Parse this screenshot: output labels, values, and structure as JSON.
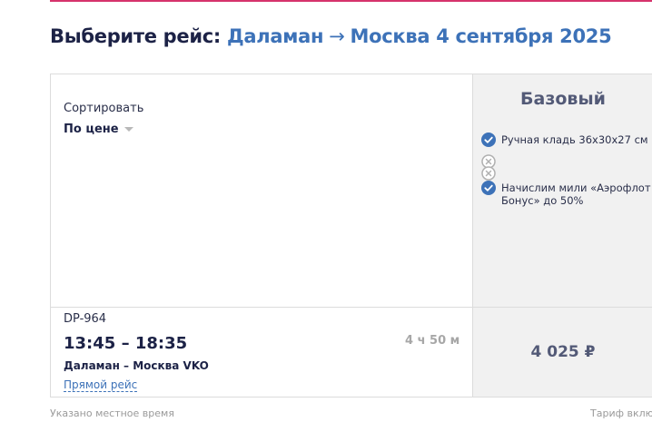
{
  "header": {
    "label": "Выберите рейс:",
    "origin": "Даламан",
    "arrow": "→",
    "destination_date": "Москва 4 сентября 2025"
  },
  "sort": {
    "label": "Сортировать",
    "value": "По цене"
  },
  "tariff": {
    "name": "Базовый",
    "features": [
      {
        "icon": "check-icon",
        "text": "Ручная кладь 36x30x27 см"
      },
      {
        "icon": "cross-icon",
        "text": ""
      },
      {
        "icon": "cross-icon",
        "text": ""
      },
      {
        "icon": "check-icon",
        "text": "Начислим мили «Аэрофлот Бонус» до 50%"
      }
    ]
  },
  "flight": {
    "number": "DP-964",
    "time": "13:45 – 18:35",
    "duration": "4 ч 50 м",
    "route": "Даламан – Москва VKO",
    "type": "Прямой рейс",
    "price": "4 025 ₽"
  },
  "footer": {
    "note_left": "Указано местное время",
    "note_right": "Тариф вклю"
  },
  "colors": {
    "accent_blue": "#3d72b8",
    "check_icon": "#3d72b8",
    "cross_icon": "#b0b0b0",
    "top_rule": "#d6336c"
  }
}
